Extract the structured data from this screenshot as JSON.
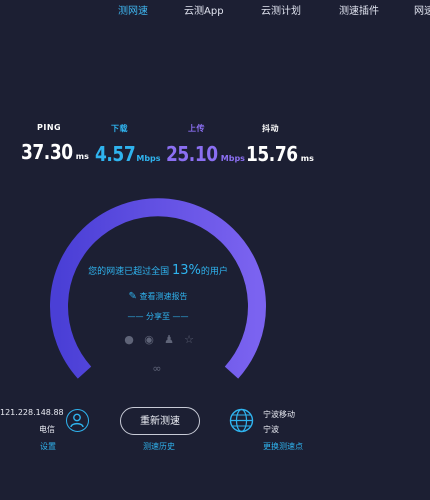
{
  "nav": {
    "items": [
      {
        "label": "测网速",
        "active": true
      },
      {
        "label": "云测App",
        "active": false
      },
      {
        "label": "云测计划",
        "active": false
      },
      {
        "label": "测速插件",
        "active": false
      },
      {
        "label": "网速",
        "active": false
      }
    ]
  },
  "metrics": [
    {
      "label": "PING",
      "value": "37.30",
      "unit": "ms",
      "color": "#ffffff"
    },
    {
      "label": "下载",
      "value": "4.57",
      "unit": "Mbps",
      "color": "#2fb3ee"
    },
    {
      "label": "上传",
      "value": "25.10",
      "unit": "Mbps",
      "color": "#8b6ff2"
    },
    {
      "label": "抖动",
      "value": "15.76",
      "unit": "ms",
      "color": "#ffffff"
    }
  ],
  "result": {
    "beat_prefix": "您的网速已超过全国",
    "beat_percent": "13%",
    "beat_suffix": "的用户",
    "report_label": "查看测速报告",
    "share_label": "—— 分享至 ——",
    "share_icons": [
      "wechat-icon",
      "weibo-icon",
      "qq-icon",
      "star-icon"
    ]
  },
  "client": {
    "ip": "121.228.148.88",
    "isp": "电信",
    "settings_label": "设置"
  },
  "actions": {
    "retest_label": "重新测速",
    "history_label": "测速历史"
  },
  "server": {
    "provider": "宁波移动",
    "city": "宁波",
    "change_label": "更换测速点"
  },
  "colors": {
    "accent_blue": "#2fb3ee",
    "gauge_start": "#4a3fd6",
    "gauge_end": "#7b63f0",
    "background": "#1c1f33"
  }
}
